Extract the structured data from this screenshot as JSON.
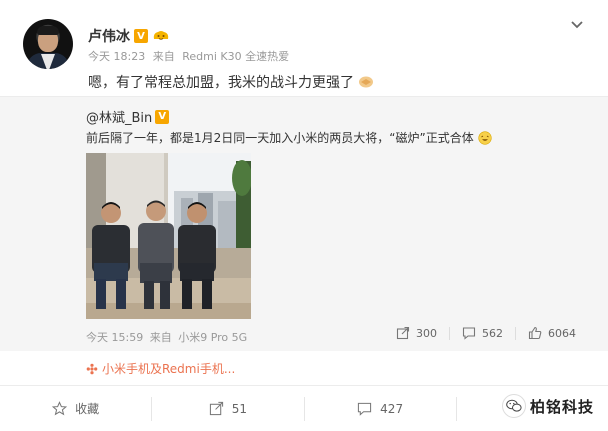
{
  "post": {
    "author": "卢伟冰",
    "meta": {
      "time": "今天 18:23",
      "source_prefix": "来自",
      "source": "Redmi K30 全速热爱"
    },
    "text": "嗯，有了常程总加盟，我米的战斗力更强了"
  },
  "repost": {
    "author": "@林斌_Bin",
    "text": "前后隔了一年，都是1月2日同一天加入小米的两员大将，“磁炉”正式合体",
    "meta": {
      "time": "今天 15:59",
      "source_prefix": "来自",
      "source": "小米9 Pro 5G"
    },
    "stats": {
      "reposts": "300",
      "comments": "562",
      "likes": "6064"
    }
  },
  "topic": "小米手机及Redmi手机...",
  "actions": {
    "favorite": "收藏",
    "repost": "51",
    "comment": "427"
  },
  "watermark": "柏铭科技",
  "colors": {
    "badge": "#f7a600",
    "topic": "#eb7350",
    "muted": "#999999",
    "repost_bg": "#f5f5f5"
  }
}
